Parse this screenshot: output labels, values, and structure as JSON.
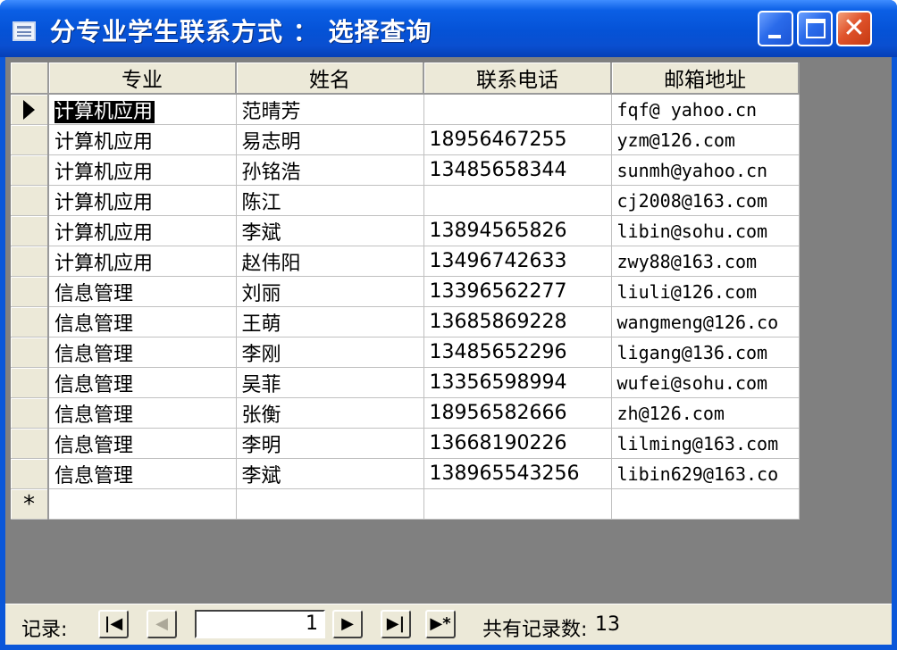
{
  "window": {
    "title": "分专业学生联系方式 ： 选择查询",
    "minimize_glyph": "",
    "maximize_glyph": "",
    "close_glyph": "✕"
  },
  "table": {
    "columns": [
      "专业",
      "姓名",
      "联系电话",
      "邮箱地址"
    ],
    "rows": [
      {
        "major": "计算机应用",
        "name": "范晴芳",
        "phone": "",
        "email": "fqf@ yahoo.cn"
      },
      {
        "major": "计算机应用",
        "name": "易志明",
        "phone": "18956467255",
        "email": "yzm@126.com"
      },
      {
        "major": "计算机应用",
        "name": "孙铭浩",
        "phone": "13485658344",
        "email": "sunmh@yahoo.cn"
      },
      {
        "major": "计算机应用",
        "name": "陈江",
        "phone": "",
        "email": "cj2008@163.com"
      },
      {
        "major": "计算机应用",
        "name": "李斌",
        "phone": "13894565826",
        "email": "libin@sohu.com"
      },
      {
        "major": "计算机应用",
        "name": "赵伟阳",
        "phone": "13496742633",
        "email": "zwy88@163.com"
      },
      {
        "major": "信息管理",
        "name": "刘丽",
        "phone": "13396562277",
        "email": "liuli@126.com"
      },
      {
        "major": "信息管理",
        "name": "王萌",
        "phone": "13685869228",
        "email": "wangmeng@126.co"
      },
      {
        "major": "信息管理",
        "name": "李刚",
        "phone": "13485652296",
        "email": "ligang@136.com"
      },
      {
        "major": "信息管理",
        "name": "吴菲",
        "phone": "13356598994",
        "email": "wufei@sohu.com"
      },
      {
        "major": "信息管理",
        "name": "张衡",
        "phone": "18956582666",
        "email": "zh@126.com"
      },
      {
        "major": "信息管理",
        "name": "李明",
        "phone": "13668190226",
        "email": "lilming@163.com"
      },
      {
        "major": "信息管理",
        "name": "李斌",
        "phone": "138965543256",
        "email": "libin629@163.co"
      }
    ],
    "current_marker": "▶",
    "new_record_marker": "*"
  },
  "navigation": {
    "label": "记录:",
    "first_glyph": "|◀",
    "prev_glyph": "◀",
    "current_record": "1",
    "next_glyph": "▶",
    "last_glyph": "▶|",
    "new_glyph": "▶*",
    "count_label": "共有记录数:",
    "count_value": "13"
  },
  "colors": {
    "titlebar": "#0552d6",
    "close_button": "#e0532b",
    "workspace": "#808080",
    "selector_gray": "#ece9d8"
  },
  "icons": {
    "app": "datasheet-icon",
    "minimize": "minimize-icon",
    "maximize": "maximize-icon",
    "close": "close-icon"
  }
}
